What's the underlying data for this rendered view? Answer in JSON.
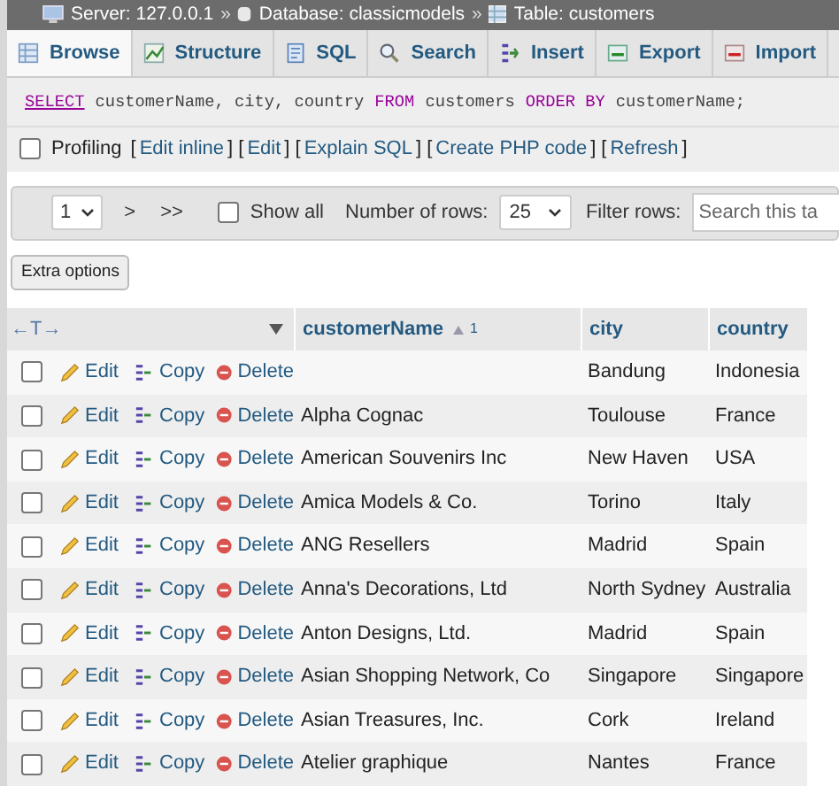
{
  "breadcrumb": [
    {
      "kind": "server",
      "text": "Server: 127.0.0.1"
    },
    {
      "kind": "database",
      "text": "Database: classicmodels"
    },
    {
      "kind": "table",
      "text": "Table: customers"
    }
  ],
  "breadcrumb_separator": "»",
  "tabs": [
    {
      "label": "Browse",
      "selected": true
    },
    {
      "label": "Structure",
      "selected": false
    },
    {
      "label": "SQL",
      "selected": false
    },
    {
      "label": "Search",
      "selected": false
    },
    {
      "label": "Insert",
      "selected": false
    },
    {
      "label": "Export",
      "selected": false
    },
    {
      "label": "Import",
      "selected": false
    }
  ],
  "sql": [
    {
      "kind": "keyword",
      "text": "SELECT"
    },
    {
      "kind": "plain",
      "text": "customerName, city, country"
    },
    {
      "kind": "keyword",
      "text": "FROM"
    },
    {
      "kind": "plain",
      "text": "customers"
    },
    {
      "kind": "keyword",
      "text": "ORDER BY"
    },
    {
      "kind": "plain",
      "text": "customerName;"
    }
  ],
  "profiling": {
    "label": "Profiling",
    "checked": false,
    "items": [
      {
        "kind": "bracket",
        "text": "["
      },
      {
        "kind": "link",
        "text": "Edit inline"
      },
      {
        "kind": "bracket",
        "text": "] ["
      },
      {
        "kind": "link",
        "text": "Edit"
      },
      {
        "kind": "bracket",
        "text": "] ["
      },
      {
        "kind": "link",
        "text": "Explain SQL"
      },
      {
        "kind": "bracket",
        "text": "] ["
      },
      {
        "kind": "link",
        "text": "Create PHP code"
      },
      {
        "kind": "bracket",
        "text": "] ["
      },
      {
        "kind": "link",
        "text": "Refresh"
      },
      {
        "kind": "bracket",
        "text": "]"
      }
    ]
  },
  "navigation": {
    "page": "1",
    "next": ">",
    "last": ">>",
    "show_all": {
      "label": "Show all",
      "checked": false
    },
    "rows_label": "Number of rows:",
    "rows": "25",
    "filter_label": "Filter rows:",
    "filter_placeholder": "Search this ta"
  },
  "extra_options": "Extra options",
  "table": {
    "move_columns": "←T→",
    "columns": [
      {
        "label": "customerName",
        "sort": "1"
      },
      {
        "label": "city"
      },
      {
        "label": "country"
      }
    ],
    "rows": [
      {
        "checked": false,
        "edit": "Edit",
        "copy": "Copy",
        "delete": "Delete",
        "cells": [
          "",
          "Bandung",
          "Indonesia"
        ]
      },
      {
        "checked": false,
        "edit": "Edit",
        "copy": "Copy",
        "delete": "Delete",
        "cells": [
          "Alpha Cognac",
          "Toulouse",
          "France"
        ]
      },
      {
        "checked": false,
        "edit": "Edit",
        "copy": "Copy",
        "delete": "Delete",
        "cells": [
          "American Souvenirs Inc",
          "New Haven",
          "USA"
        ]
      },
      {
        "checked": false,
        "edit": "Edit",
        "copy": "Copy",
        "delete": "Delete",
        "cells": [
          "Amica Models & Co.",
          "Torino",
          "Italy"
        ]
      },
      {
        "checked": false,
        "edit": "Edit",
        "copy": "Copy",
        "delete": "Delete",
        "cells": [
          "ANG Resellers",
          "Madrid",
          "Spain"
        ]
      },
      {
        "checked": false,
        "edit": "Edit",
        "copy": "Copy",
        "delete": "Delete",
        "cells": [
          "Anna's Decorations, Ltd",
          "North Sydney",
          "Australia"
        ]
      },
      {
        "checked": false,
        "edit": "Edit",
        "copy": "Copy",
        "delete": "Delete",
        "cells": [
          "Anton Designs, Ltd.",
          "Madrid",
          "Spain"
        ]
      },
      {
        "checked": false,
        "edit": "Edit",
        "copy": "Copy",
        "delete": "Delete",
        "cells": [
          "Asian Shopping Network, Co",
          "Singapore",
          "Singapore"
        ]
      },
      {
        "checked": false,
        "edit": "Edit",
        "copy": "Copy",
        "delete": "Delete",
        "cells": [
          "Asian Treasures, Inc.",
          "Cork",
          "Ireland"
        ]
      },
      {
        "checked": false,
        "edit": "Edit",
        "copy": "Copy",
        "delete": "Delete",
        "cells": [
          "Atelier graphique",
          "Nantes",
          "France"
        ]
      }
    ]
  }
}
